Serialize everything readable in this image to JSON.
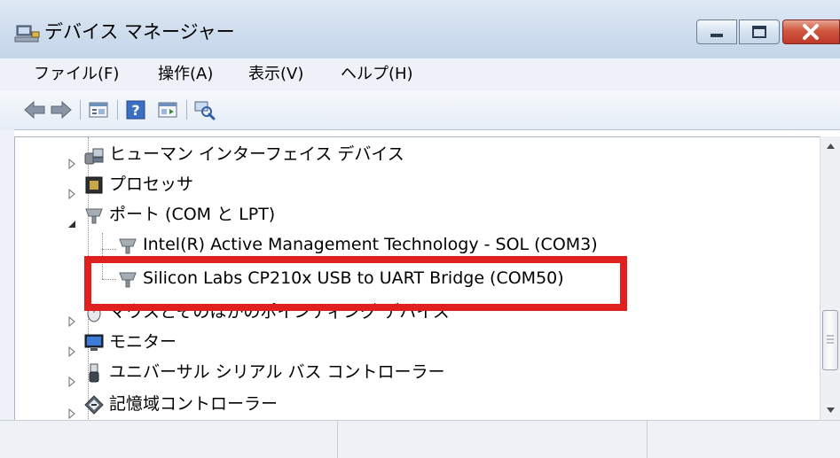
{
  "window": {
    "title": "デバイス マネージャー",
    "icon": "device-manager-icon",
    "buttons": [
      "minimize-icon",
      "maximize-icon",
      "close-icon"
    ]
  },
  "menu": {
    "items": [
      {
        "label": "ファイル(F)"
      },
      {
        "label": "操作(A)"
      },
      {
        "label": "表示(V)"
      },
      {
        "label": "ヘルプ(H)"
      }
    ]
  },
  "toolbar": {
    "buttons": [
      "back-arrow-icon",
      "forward-arrow-icon",
      "properties-view-icon",
      "help-icon",
      "action-view-icon",
      "scan-hardware-icon"
    ]
  },
  "tree": {
    "nodes": [
      {
        "label": "ヒューマン インターフェイス デバイス",
        "icon": "hid-icon",
        "expanded": false
      },
      {
        "label": "プロセッサ",
        "icon": "processor-icon",
        "expanded": false
      },
      {
        "label": "ポート (COM と LPT)",
        "icon": "port-icon",
        "expanded": true
      },
      {
        "label": "Intel(R) Active Management Technology - SOL (COM3)",
        "icon": "port-icon",
        "child": true
      },
      {
        "label": "Silicon Labs CP210x USB to UART Bridge (COM50)",
        "icon": "port-icon",
        "child": true,
        "highlighted": true
      },
      {
        "label": "マウスとそのほかのポインティング デバイス",
        "icon": "mouse-icon",
        "expanded": false
      },
      {
        "label": "モニター",
        "icon": "monitor-icon",
        "expanded": false
      },
      {
        "label": "ユニバーサル シリアル バス コントローラー",
        "icon": "usb-icon",
        "expanded": false
      },
      {
        "label": "記憶域コントローラー",
        "icon": "storage-controller-icon",
        "expanded": false
      }
    ]
  },
  "colors": {
    "highlight_border": "#e02020",
    "title_gradient": "#cddced",
    "close_button": "#c0392b"
  }
}
